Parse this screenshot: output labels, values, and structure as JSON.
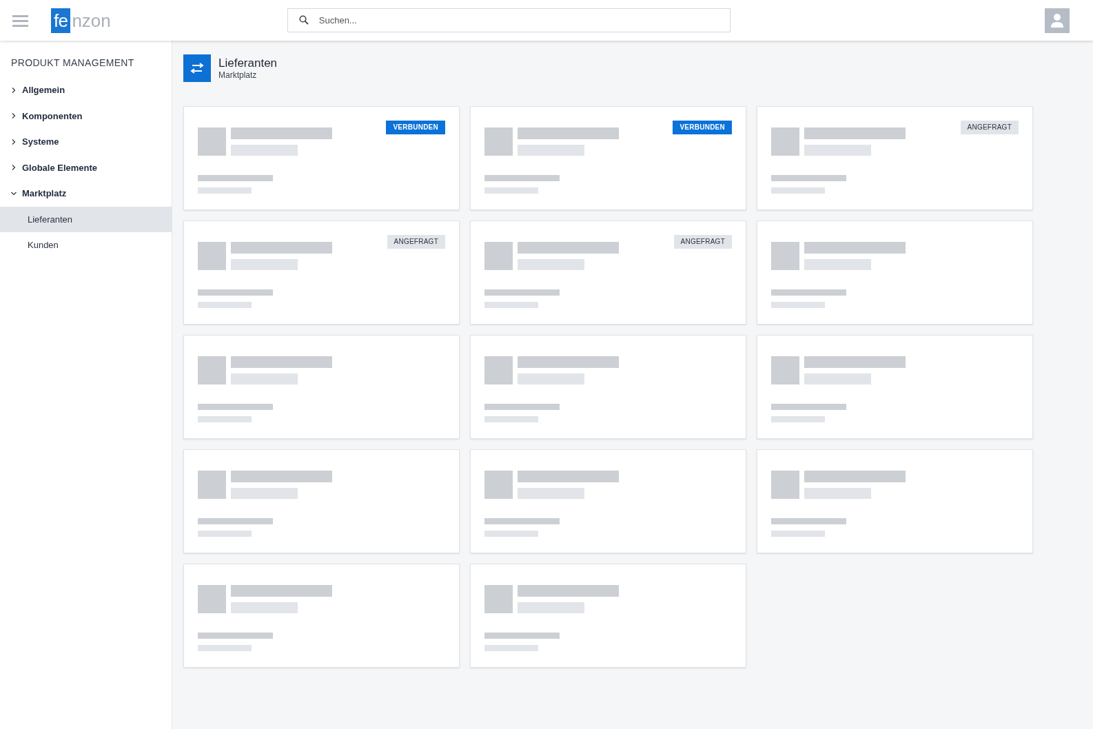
{
  "header": {
    "logo": {
      "mark": "fe",
      "rest": "nzon"
    },
    "search": {
      "placeholder": "Suchen..."
    }
  },
  "sidebar": {
    "heading": "PRODUKT MANAGEMENT",
    "items": [
      {
        "label": "Allgemein",
        "expanded": false
      },
      {
        "label": "Komponenten",
        "expanded": false
      },
      {
        "label": "Systeme",
        "expanded": false
      },
      {
        "label": "Globale Elemente",
        "expanded": false
      },
      {
        "label": "Marktplatz",
        "expanded": true,
        "children": [
          {
            "label": "Lieferanten",
            "selected": true
          },
          {
            "label": "Kunden",
            "selected": false
          }
        ]
      }
    ]
  },
  "page": {
    "title": "Lieferanten",
    "subtitle": "Marktplatz"
  },
  "cards": [
    {
      "kind": "connected",
      "badge": "VERBUNDEN"
    },
    {
      "kind": "connected",
      "badge": "VERBUNDEN"
    },
    {
      "kind": "requested",
      "badge": "ANGEFRAGT"
    },
    {
      "kind": "requested",
      "badge": "ANGEFRAGT"
    },
    {
      "kind": "requested",
      "badge": "ANGEFRAGT"
    },
    {
      "kind": "plain"
    },
    {
      "kind": "plain"
    },
    {
      "kind": "plain"
    },
    {
      "kind": "plain"
    },
    {
      "kind": "plain"
    },
    {
      "kind": "plain"
    },
    {
      "kind": "plain"
    },
    {
      "kind": "plain"
    },
    {
      "kind": "plain"
    }
  ]
}
